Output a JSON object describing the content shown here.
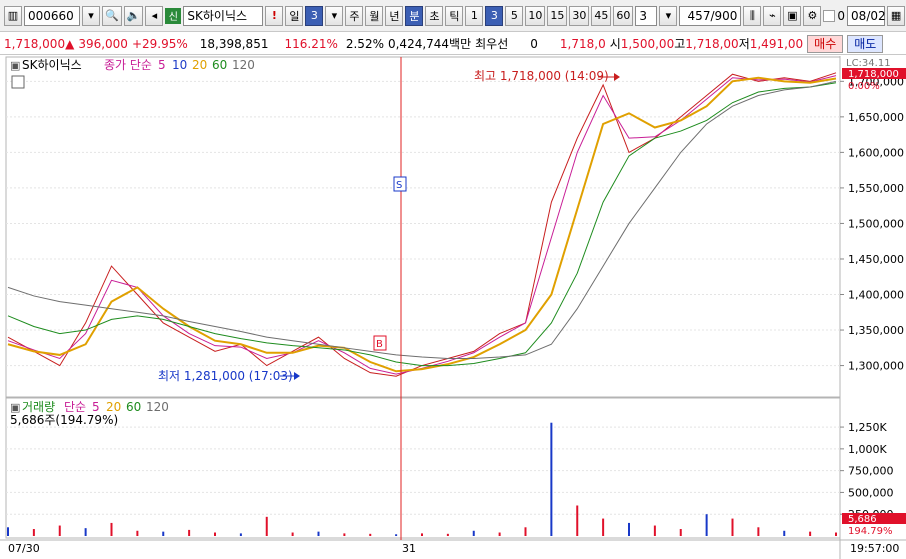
{
  "toolbar": {
    "code": "000660",
    "badge": "신",
    "stock_name": "SK하이닉스",
    "warn": "!",
    "period_day": "일",
    "period_value": "3",
    "periods": [
      "주",
      "월",
      "년",
      "분",
      "초",
      "틱"
    ],
    "minutes": [
      "1",
      "3",
      "5",
      "10",
      "15",
      "30",
      "45",
      "60"
    ],
    "interval_value": "3",
    "count": "457",
    "count_total": "/900",
    "date_flag": "0",
    "date": "08/02"
  },
  "quote": {
    "price": "1,718,000",
    "change": "396,000",
    "change_pct": "+29.95%",
    "volume": "18,398,851",
    "vol_ratio": "116.21%",
    "turnover_pct": "2.52%",
    "trade_value": "0,424,744백만",
    "best_label": "최우선",
    "best_value": "0",
    "ask": "1,718,0",
    "open_label": "시",
    "open": "1,500,00",
    "high_label": "고",
    "high": "1,718,00",
    "low_label": "저",
    "low": "1,491,00",
    "buy_label": "매수",
    "sell_label": "매도"
  },
  "price_panel": {
    "stock_label": "SK하이닉스",
    "ma_title": "종가 단순",
    "ma_periods": [
      "5",
      "10",
      "20",
      "60",
      "120"
    ],
    "ma_colors": [
      "#c81e96",
      "#1e3cc8",
      "#e0a000",
      "#1e8c1e",
      "#6e6e6e"
    ],
    "lc_label": "LC:34.11",
    "current_tag": "1,718,000",
    "current_pct": "0.00%",
    "high_annotation": "최고 1,718,000 (14:09)",
    "low_annotation": "최저 1,281,000 (17:03)",
    "sell_marker": "S",
    "buy_marker": "B"
  },
  "volume_panel": {
    "title": "거래량",
    "ma_title": "단순",
    "ma_periods": [
      "5",
      "20",
      "60",
      "120"
    ],
    "ma_colors": [
      "#c81e96",
      "#e0a000",
      "#1e8c1e",
      "#6e6e6e"
    ],
    "current": "5,686주(194.79%)",
    "current_tag": "5,686",
    "current_pct": "194.79%"
  },
  "time_axis": {
    "labels": [
      "07/30",
      "31"
    ],
    "current_time": "19:57:00"
  },
  "chart_data": [
    {
      "type": "line",
      "title": "SK하이닉스",
      "ylabel": "",
      "ylim": [
        1260000,
        1730000
      ],
      "y_ticks": [
        1300000,
        1350000,
        1400000,
        1450000,
        1500000,
        1550000,
        1600000,
        1650000,
        1700000
      ],
      "y_tick_labels": [
        "1,300,000",
        "1,350,000",
        "1,400,000",
        "1,450,000",
        "1,500,000",
        "1,550,000",
        "1,600,000",
        "1,650,000",
        "1,700,000"
      ],
      "x": [
        0,
        5,
        10,
        15,
        20,
        25,
        30,
        35,
        40,
        45,
        50,
        55,
        60,
        65,
        70,
        75,
        80,
        85,
        90,
        95,
        100,
        105,
        110,
        115,
        120,
        125,
        130,
        135,
        140,
        145,
        150,
        155,
        160
      ],
      "series": [
        {
          "name": "price",
          "values": [
            1340000,
            1320000,
            1300000,
            1360000,
            1440000,
            1400000,
            1360000,
            1340000,
            1320000,
            1330000,
            1300000,
            1320000,
            1340000,
            1310000,
            1290000,
            1285000,
            1300000,
            1310000,
            1320000,
            1345000,
            1360000,
            1530000,
            1620000,
            1695000,
            1600000,
            1620000,
            1650000,
            1680000,
            1710000,
            1700000,
            1705000,
            1700000,
            1712000
          ]
        },
        {
          "name": "5",
          "values": [
            1335000,
            1322000,
            1310000,
            1345000,
            1420000,
            1410000,
            1370000,
            1345000,
            1328000,
            1326000,
            1310000,
            1318000,
            1335000,
            1318000,
            1296000,
            1288000,
            1296000,
            1306000,
            1318000,
            1340000,
            1360000,
            1480000,
            1600000,
            1680000,
            1620000,
            1622000,
            1645000,
            1675000,
            1705000,
            1702000,
            1703000,
            1699000,
            1708000
          ]
        },
        {
          "name": "20",
          "values": [
            1330000,
            1320000,
            1315000,
            1330000,
            1390000,
            1410000,
            1380000,
            1355000,
            1335000,
            1330000,
            1318000,
            1318000,
            1328000,
            1325000,
            1305000,
            1292000,
            1295000,
            1302000,
            1312000,
            1330000,
            1350000,
            1400000,
            1520000,
            1640000,
            1655000,
            1635000,
            1645000,
            1665000,
            1700000,
            1705000,
            1700000,
            1698000,
            1704000
          ]
        },
        {
          "name": "60",
          "values": [
            1370000,
            1355000,
            1345000,
            1350000,
            1365000,
            1370000,
            1365000,
            1355000,
            1345000,
            1338000,
            1332000,
            1328000,
            1325000,
            1322000,
            1315000,
            1305000,
            1300000,
            1300000,
            1303000,
            1310000,
            1318000,
            1360000,
            1430000,
            1530000,
            1595000,
            1620000,
            1630000,
            1645000,
            1670000,
            1685000,
            1690000,
            1692000,
            1698000
          ]
        },
        {
          "name": "120",
          "values": [
            1410000,
            1398000,
            1390000,
            1385000,
            1380000,
            1375000,
            1370000,
            1362000,
            1355000,
            1348000,
            1340000,
            1335000,
            1330000,
            1325000,
            1320000,
            1315000,
            1312000,
            1310000,
            1310000,
            1312000,
            1315000,
            1330000,
            1380000,
            1440000,
            1500000,
            1550000,
            1600000,
            1640000,
            1665000,
            1680000,
            1688000,
            1692000,
            1700000
          ]
        }
      ]
    },
    {
      "type": "bar",
      "title": "거래량",
      "ylim": [
        0,
        1400000
      ],
      "y_ticks": [
        250000,
        500000,
        750000,
        1000000,
        1250000
      ],
      "y_tick_labels": [
        "250,000",
        "500,000",
        "750,000",
        "1,000K",
        "1,250K"
      ],
      "x": [
        0,
        5,
        10,
        15,
        20,
        25,
        30,
        35,
        40,
        45,
        50,
        55,
        60,
        65,
        70,
        75,
        80,
        85,
        90,
        95,
        100,
        105,
        110,
        115,
        120,
        125,
        130,
        135,
        140,
        145,
        150,
        155,
        160
      ],
      "values": [
        100000,
        80000,
        120000,
        90000,
        150000,
        60000,
        50000,
        70000,
        40000,
        30000,
        220000,
        40000,
        50000,
        30000,
        25000,
        20000,
        30000,
        25000,
        60000,
        40000,
        100000,
        1300000,
        350000,
        200000,
        150000,
        120000,
        80000,
        250000,
        200000,
        100000,
        60000,
        50000,
        40000
      ]
    }
  ]
}
